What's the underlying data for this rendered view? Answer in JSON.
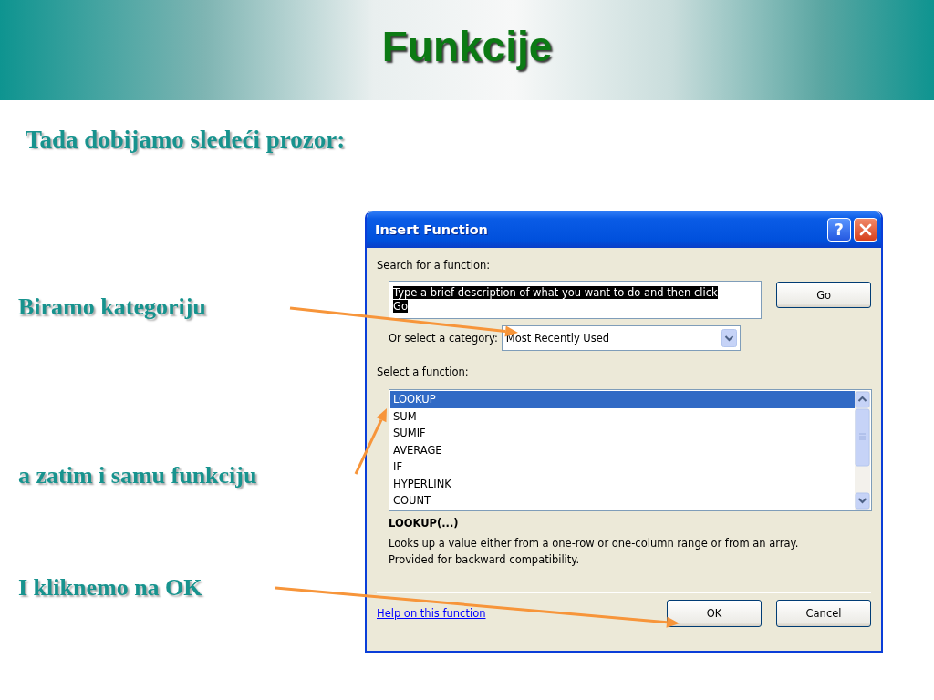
{
  "slide": {
    "title": "Funkcije",
    "subtitle": "Tada dobijamo sledeći prozor:",
    "callouts": [
      {
        "text": "Biramo kategoriju"
      },
      {
        "text": "a zatim i samu funkciju"
      },
      {
        "text": "I kliknemo na OK"
      }
    ]
  },
  "dialog": {
    "title": "Insert Function",
    "help_button": "?",
    "search_label": "Search for a function:",
    "search_field": {
      "value": "Type a brief description of what you want to do and then click Go",
      "highlighted": true
    },
    "go_button": "Go",
    "category_label": "Or select a category:",
    "category_value": "Most Recently Used",
    "function_label": "Select a function:",
    "functions": [
      {
        "name": "LOOKUP",
        "selected": true
      },
      {
        "name": "SUM",
        "selected": false
      },
      {
        "name": "SUMIF",
        "selected": false
      },
      {
        "name": "AVERAGE",
        "selected": false
      },
      {
        "name": "IF",
        "selected": false
      },
      {
        "name": "HYPERLINK",
        "selected": false
      },
      {
        "name": "COUNT",
        "selected": false
      }
    ],
    "signature": "LOOKUP(...)",
    "description": "Looks up a value either from a one-row or one-column range or from an array. Provided for backward compatibility.",
    "help_link": "Help on this function",
    "ok_button": "OK",
    "cancel_button": "Cancel"
  }
}
